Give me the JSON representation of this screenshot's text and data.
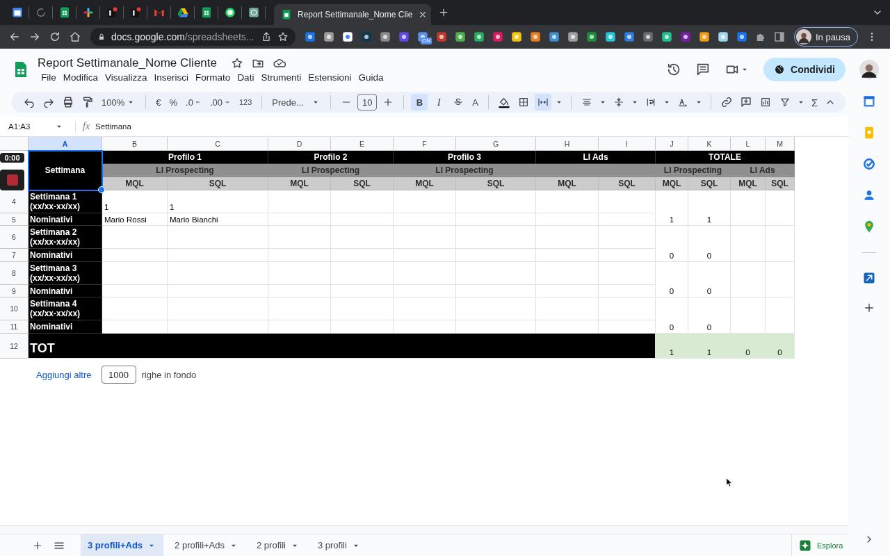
{
  "browser": {
    "tab_title": "Report Settimanale_Nome Clie",
    "url_host": "docs.google.com",
    "url_path": "/spreadsheets...",
    "extension_badge": "ON",
    "profile_status": "In pausa"
  },
  "document": {
    "title": "Report Settimanale_Nome Cliente",
    "menu": [
      "File",
      "Modifica",
      "Visualizza",
      "Inserisci",
      "Formato",
      "Dati",
      "Strumenti",
      "Estensioni",
      "Guida"
    ],
    "share": "Condividi"
  },
  "toolbar": {
    "zoom": "100%",
    "currency": "€",
    "percent": "%",
    "decrease_decimals": ".0",
    "increase_decimals": ".00",
    "number_format": "123",
    "font": "Prede...",
    "font_size": "10",
    "bold": {
      "label": "B",
      "selected": true
    },
    "italic": {
      "label": "I",
      "selected": false
    },
    "text_color": "A",
    "merge_cells": {
      "selected": true
    },
    "functions": "Σ"
  },
  "formula_bar": {
    "name_box": "A1:A3",
    "fx": "fx",
    "content": "Settimana"
  },
  "recorder": {
    "time": "0:00"
  },
  "sheet": {
    "columns": [
      {
        "label": "A",
        "selected": true
      },
      {
        "label": "B",
        "selected": false
      },
      {
        "label": "C",
        "selected": false
      },
      {
        "label": "D",
        "selected": false
      },
      {
        "label": "E",
        "selected": false
      },
      {
        "label": "F",
        "selected": false
      },
      {
        "label": "G",
        "selected": false
      },
      {
        "label": "H",
        "selected": false
      },
      {
        "label": "I",
        "selected": false
      },
      {
        "label": "J",
        "selected": false
      },
      {
        "label": "K",
        "selected": false
      },
      {
        "label": "L",
        "selected": false
      },
      {
        "label": "M",
        "selected": false
      }
    ],
    "row_headers": [
      {
        "label": "4",
        "selected": false
      },
      {
        "label": "5",
        "selected": false
      },
      {
        "label": "6",
        "selected": false
      },
      {
        "label": "7",
        "selected": false
      },
      {
        "label": "8",
        "selected": false
      },
      {
        "label": "9",
        "selected": false
      },
      {
        "label": "10",
        "selected": false
      },
      {
        "label": "11",
        "selected": false
      },
      {
        "label": "12",
        "selected": false
      }
    ],
    "corner": "Settimana",
    "profiles": {
      "B:C": "Profilo 1",
      "D:E": "Profilo 2",
      "F:G": "Profilo 3",
      "H:I": "LI Ads",
      "J:M": "TOTALE"
    },
    "channels": {
      "B:C": "LI Prospecting",
      "D:E": "LI Prospecting",
      "F:G": "LI Prospecting",
      "J:K": "LI Prospecting",
      "L:M": "LI Ads"
    },
    "metrics": {
      "B": "MQL",
      "C": "SQL",
      "D": "MQL",
      "E": "SQL",
      "F": "MQL",
      "G": "SQL",
      "H": "MQL",
      "I": "SQL",
      "J": "MQL",
      "K": "SQL",
      "L": "MQL",
      "M": "SQL"
    },
    "weeks": [
      {
        "label": "Settimana 1 (xx/xx-xx/xx)",
        "entries": {
          "B": "1",
          "C": "1"
        },
        "names_label": "Nominativi",
        "names": {
          "B": "Mario Rossi",
          "C": "Mario Bianchi"
        },
        "totals": {
          "J": "1",
          "K": "1"
        }
      },
      {
        "label": "Settimana 2 (xx/xx-xx/xx)",
        "names_label": "Nominativi",
        "totals": {
          "J": "0",
          "K": "0"
        }
      },
      {
        "label": "Settimana 3 (xx/xx-xx/xx)",
        "names_label": "Nominativi",
        "totals": {
          "J": "0",
          "K": "0"
        }
      },
      {
        "label": "Settimana 4 (xx/xx-xx/xx)",
        "names_label": "Nominativi",
        "totals": {
          "J": "0",
          "K": "0"
        }
      }
    ],
    "total": {
      "label": "TOT",
      "totals": {
        "J": "1",
        "K": "1",
        "L": "0",
        "M": "0"
      }
    },
    "add_rows": {
      "link": "Aggiungi altre",
      "count": "1000",
      "suffix": "righe in fondo"
    }
  },
  "sheet_tabs": [
    {
      "label": "3 profili+Ads",
      "selected": true
    },
    {
      "label": "2 profili+Ads",
      "selected": false
    },
    {
      "label": "2 profili",
      "selected": false
    },
    {
      "label": "3 profili",
      "selected": false
    }
  ],
  "explore": "Esplora"
}
